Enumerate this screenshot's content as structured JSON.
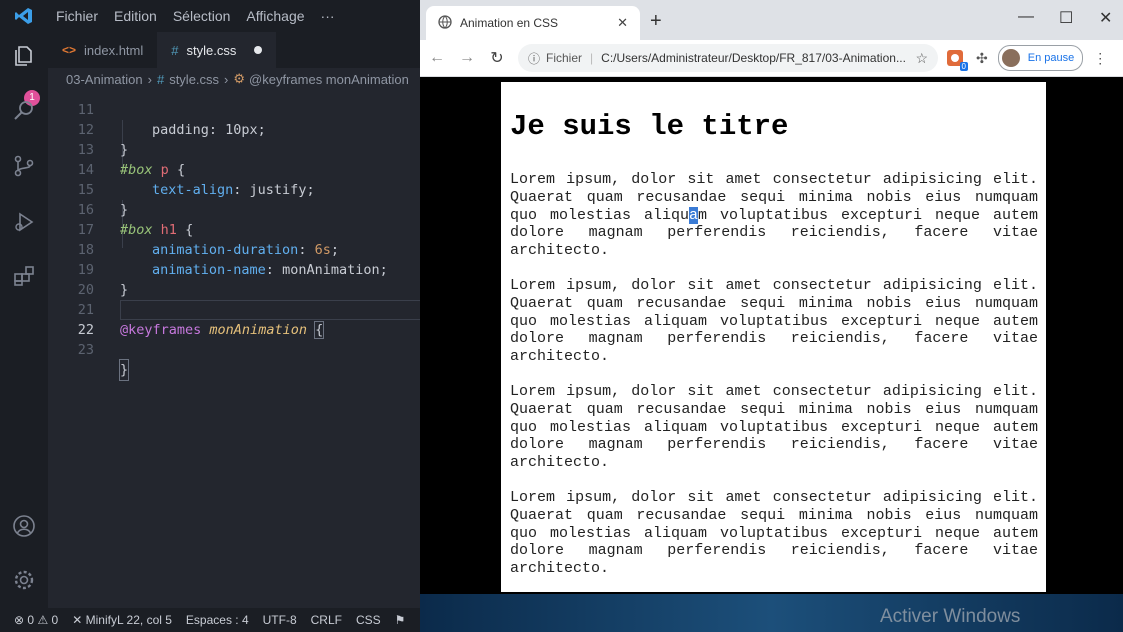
{
  "vscode": {
    "menu": [
      "Fichier",
      "Edition",
      "Sélection",
      "Affichage",
      "···"
    ],
    "badge_count": "1",
    "tabs": [
      {
        "icon": "<>",
        "label": "index.html"
      },
      {
        "icon": "#",
        "label": "style.css"
      }
    ],
    "breadcrumb": {
      "folder": "03-Animation",
      "file": "style.css",
      "symbol": "@keyframes monAnimation"
    },
    "lines": {
      "l11": {
        "num": "11",
        "text": "padding: 10px;"
      },
      "l12": {
        "num": "12",
        "text": "}"
      },
      "l13": {
        "num": "13",
        "sel": "#box",
        "el": "p",
        "brace": "{"
      },
      "l14": {
        "num": "14",
        "prop": "text-align",
        "val": "justify;"
      },
      "l15": {
        "num": "15",
        "text": "}"
      },
      "l16": {
        "num": "16",
        "sel": "#box",
        "el": "h1",
        "brace": "{"
      },
      "l17": {
        "num": "17",
        "prop": "animation-duration",
        "val": "6s",
        "semi": ";"
      },
      "l18": {
        "num": "18",
        "prop": "animation-name",
        "val": "monAnimation;"
      },
      "l19": {
        "num": "19",
        "text": "}"
      },
      "l20": {
        "num": "20"
      },
      "l21": {
        "num": "21",
        "at": "@keyframes",
        "name": "monAnimation",
        "brace": "{"
      },
      "l22": {
        "num": "22"
      },
      "l23": {
        "num": "23",
        "text": "}"
      }
    },
    "status": {
      "errors": "0",
      "warnings": "0",
      "minify": "Minify",
      "position": "L 22, col 5",
      "spaces": "Espaces : 4",
      "encoding": "UTF-8",
      "eol": "CRLF",
      "language": "CSS"
    }
  },
  "browser": {
    "tab_title": "Animation en CSS",
    "address_scheme": "Fichier",
    "address_path": "C:/Users/Administrateur/Desktop/FR_817/03-Animation...",
    "extension_badge": "0",
    "profile_label": "En pause",
    "page": {
      "title": "Je suis le titre",
      "paragraph": "Lorem ipsum, dolor sit amet consectetur adipisicing elit. Quaerat quam recusandae sequi minima nobis eius numquam quo molestias aliquam voluptatibus excepturi neque autem dolore magnam perferendis reiciendis, facere vitae architecto."
    }
  },
  "watermark": "Activer Windows"
}
